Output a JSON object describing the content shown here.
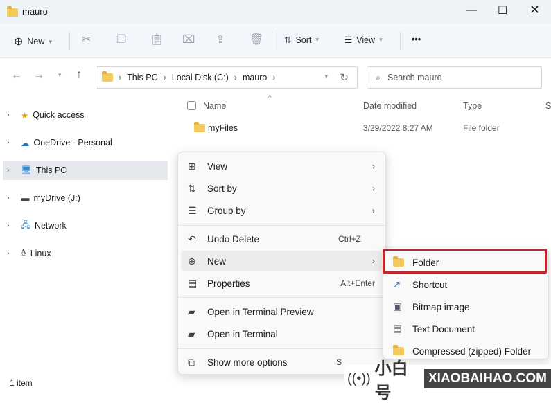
{
  "window": {
    "title": "mauro"
  },
  "toolbar": {
    "new": "New",
    "sort": "Sort",
    "view": "View",
    "more": "•••"
  },
  "nav": {
    "breadcrumb": [
      "This PC",
      "Local Disk (C:)",
      "mauro"
    ],
    "search_placeholder": "Search mauro"
  },
  "sidebar": {
    "items": [
      {
        "label": "Quick access",
        "icon": "star-icon"
      },
      {
        "label": "OneDrive - Personal",
        "icon": "cloud-icon"
      },
      {
        "label": "This PC",
        "icon": "monitor-icon",
        "selected": true
      },
      {
        "label": "myDrive (J:)",
        "icon": "drive-icon"
      },
      {
        "label": "Network",
        "icon": "network-icon"
      },
      {
        "label": "Linux",
        "icon": "penguin-icon"
      }
    ]
  },
  "columns": [
    "Name",
    "Date modified",
    "Type",
    "S"
  ],
  "files": [
    {
      "name": "myFiles",
      "date": "3/29/2022 8:27 AM",
      "type": "File folder"
    }
  ],
  "context_menu": {
    "items": [
      {
        "label": "View",
        "icon": "grid-icon",
        "submenu": true
      },
      {
        "label": "Sort by",
        "icon": "sort-icon",
        "submenu": true
      },
      {
        "label": "Group by",
        "icon": "list-icon",
        "submenu": true
      },
      {
        "label": "Undo Delete",
        "icon": "undo-icon",
        "shortcut": "Ctrl+Z"
      },
      {
        "label": "New",
        "icon": "plus-circle-icon",
        "submenu": true
      },
      {
        "label": "Properties",
        "icon": "properties-icon",
        "shortcut": "Alt+Enter"
      },
      {
        "label": "Open in Terminal Preview",
        "icon": "terminal-icon"
      },
      {
        "label": "Open in Terminal",
        "icon": "terminal-icon"
      },
      {
        "label": "Show more options",
        "icon": "expand-icon",
        "shortcut": "S"
      }
    ]
  },
  "new_submenu": {
    "items": [
      "Folder",
      "Shortcut",
      "Bitmap image",
      "Text Document",
      "Compressed (zipped) Folder"
    ]
  },
  "status": {
    "count": "1 item"
  },
  "watermark": {
    "cn": "小白号",
    "en": "XIAOBAIHAO.COM"
  },
  "colors": {
    "highlight": "#c0272d",
    "folder": "#f4c95d"
  }
}
